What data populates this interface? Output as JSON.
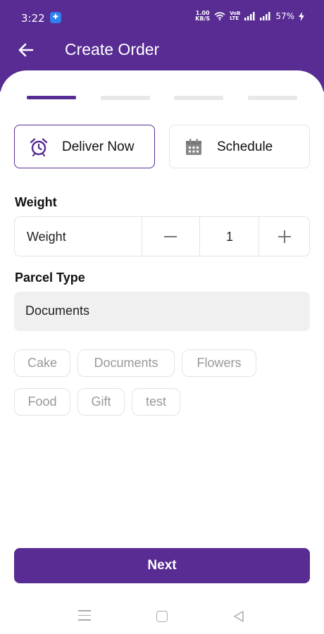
{
  "status_bar": {
    "time": "3:22",
    "speed_value": "1.00",
    "speed_unit": "KB/S",
    "volte_top": "VoB",
    "volte_bottom": "LTE",
    "battery": "57%"
  },
  "app_bar": {
    "title": "Create Order",
    "back_icon": "arrow-left-icon"
  },
  "steps": {
    "total": 4,
    "current": 1
  },
  "delivery_modes": [
    {
      "label": "Deliver Now",
      "icon": "alarm-clock-icon",
      "selected": true
    },
    {
      "label": "Schedule",
      "icon": "calendar-icon",
      "selected": false
    }
  ],
  "weight": {
    "section_label": "Weight",
    "field_label": "Weight",
    "quantity": "1"
  },
  "parcel": {
    "section_label": "Parcel Type",
    "value": "Documents",
    "chips": [
      "Cake",
      "Documents",
      "Flowers",
      "Food",
      "Gift",
      "test"
    ]
  },
  "next_button": "Next",
  "colors": {
    "primary": "#582c93",
    "field_bg": "#f0f0f0",
    "border": "#e3e3e3",
    "chip_text": "#999999"
  }
}
